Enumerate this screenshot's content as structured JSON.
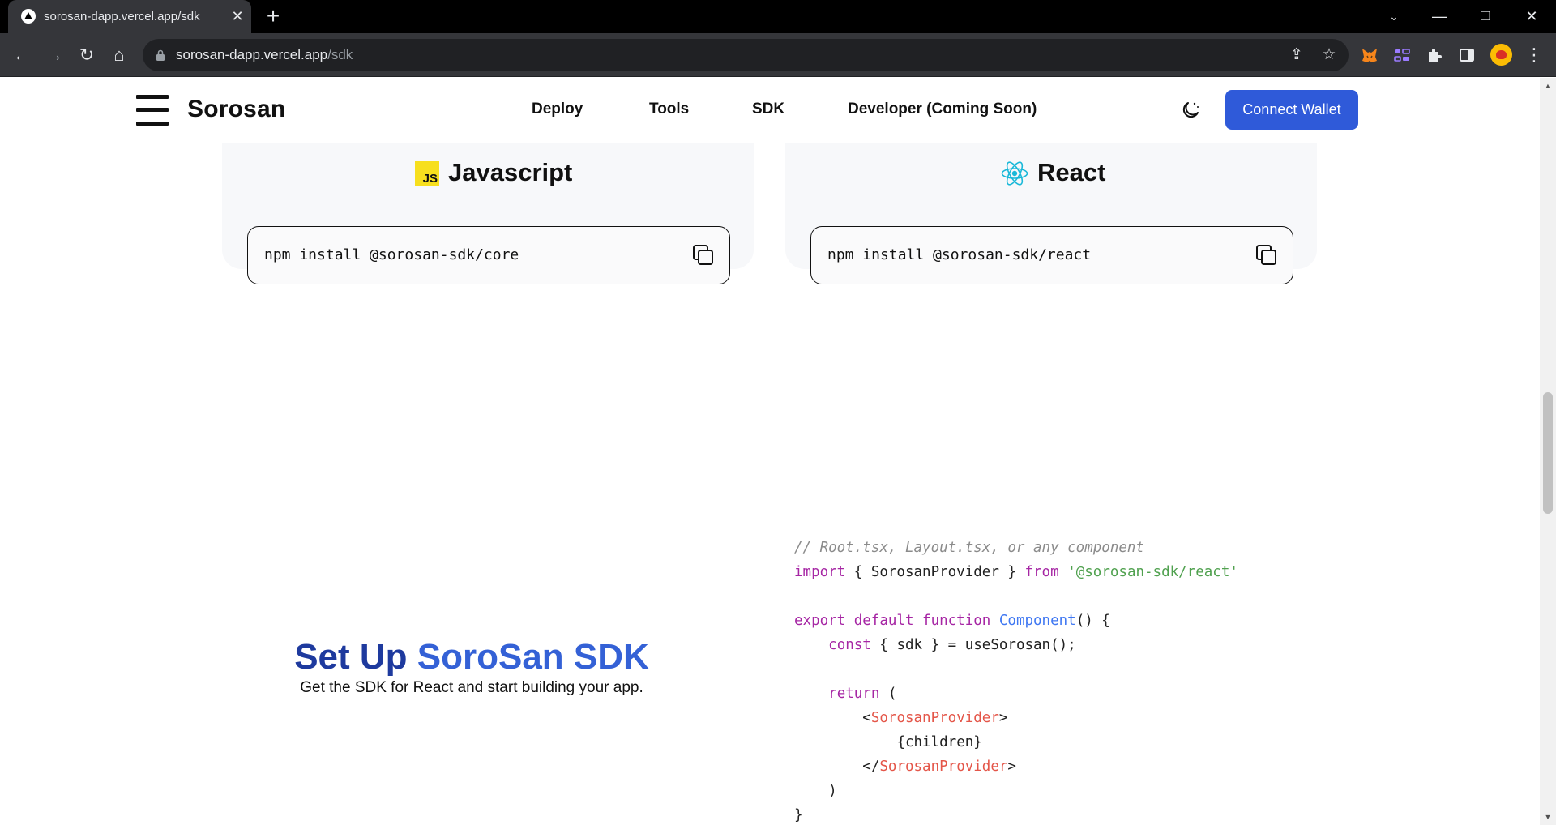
{
  "browser": {
    "tab_title": "sorosan-dapp.vercel.app/sdk",
    "url_host": "sorosan-dapp.vercel.app",
    "url_path": "/sdk"
  },
  "site": {
    "brand": "Sorosan",
    "nav": [
      "Deploy",
      "Tools",
      "SDK",
      "Developer (Coming Soon)"
    ],
    "connect_button": "Connect Wallet",
    "accent_color": "#2f5ad9"
  },
  "install_cards": [
    {
      "title": "Javascript",
      "icon": "js-icon",
      "command": "npm install @sorosan-sdk/core"
    },
    {
      "title": "React",
      "icon": "react-icon",
      "command": "npm install @sorosan-sdk/react"
    }
  ],
  "setup": {
    "title_part1": "Set Up ",
    "title_part2": "SoroSan SDK",
    "subtitle": "Get the SDK for React and start building your app."
  },
  "code": {
    "comment": "// Root.tsx, Layout.tsx, or any component",
    "import_kw": "import",
    "import_names": " { SorosanProvider } ",
    "from_kw": "from",
    "import_path": "'@sorosan-sdk/react'",
    "export_kw": "export default function",
    "fn_name": "Component",
    "fn_tail": "() {",
    "const_kw": "const",
    "const_rest": " { sdk } = useSorosan();",
    "return_kw": "return",
    "return_paren": " (",
    "open_lt": "<",
    "provider_tag": "SorosanProvider",
    "open_gt": ">",
    "children": "{children}",
    "close_lt": "</",
    "close_gt": ">",
    "close_paren": ")",
    "close_brace": "}"
  }
}
